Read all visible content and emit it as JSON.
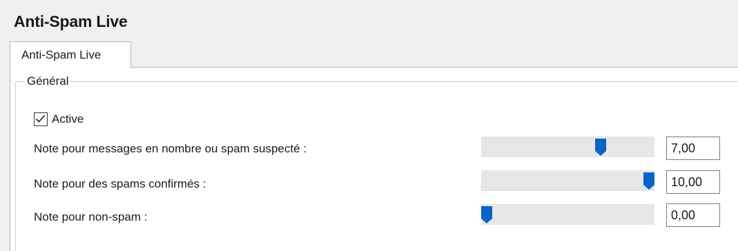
{
  "window": {
    "title": "Anti-Spam Live"
  },
  "tabs": [
    {
      "label": "Anti-Spam Live",
      "selected": true
    }
  ],
  "group": {
    "legend": "Général",
    "active": {
      "label": "Active",
      "checked": true
    },
    "rows": [
      {
        "label": "Note pour messages en nombre ou spam suspecté :",
        "value": "7,00",
        "slider_fraction": 0.7
      },
      {
        "label": "Note pour des spams confirmés :",
        "value": "10,00",
        "slider_fraction": 1.0
      },
      {
        "label": "Note pour non-spam :",
        "value": "0,00",
        "slider_fraction": 0.0
      }
    ]
  },
  "colors": {
    "accent": "#0a64c8",
    "track": "#e6e6e6"
  },
  "icons": {
    "checkbox_mark": "checkmark-icon",
    "slider_thumb": "slider-thumb-icon"
  }
}
